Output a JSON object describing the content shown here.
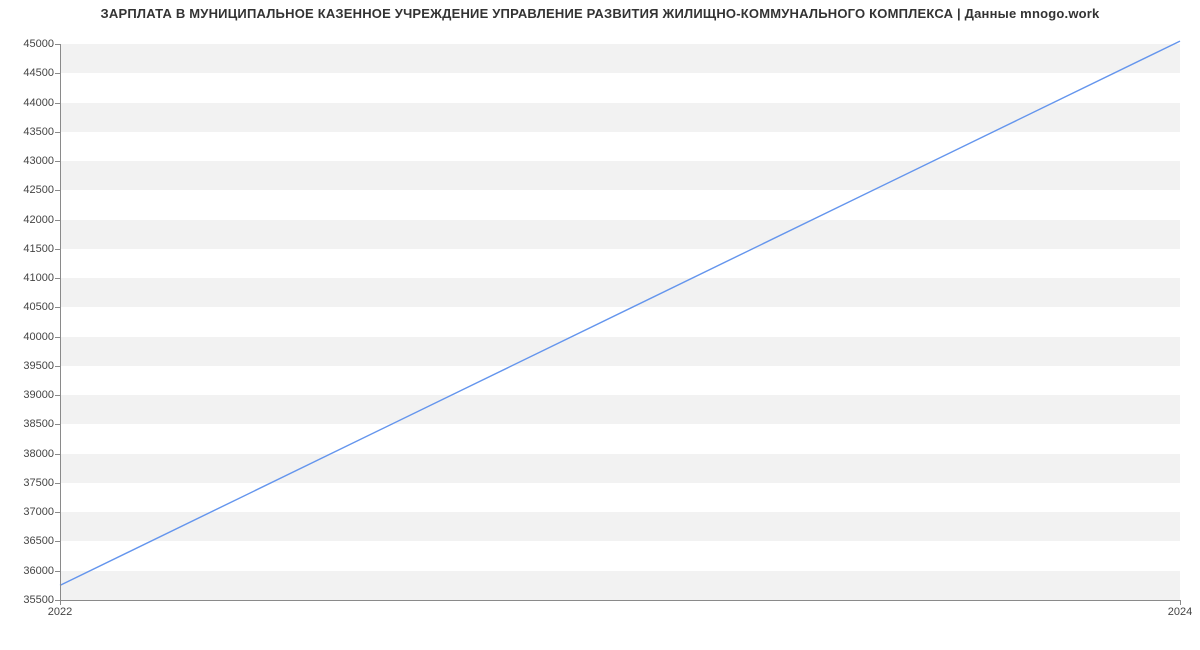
{
  "chart_data": {
    "type": "line",
    "title": "ЗАРПЛАТА В МУНИЦИПАЛЬНОЕ КАЗЕННОЕ УЧРЕЖДЕНИЕ УПРАВЛЕНИЕ РАЗВИТИЯ ЖИЛИЩНО-КОММУНАЛЬНОГО КОМПЛЕКСА | Данные mnogo.work",
    "xlabel": "",
    "ylabel": "",
    "x": [
      2022,
      2024
    ],
    "values": [
      35750,
      45050
    ],
    "x_ticks": [
      2022,
      2024
    ],
    "y_ticks": [
      35500,
      36000,
      36500,
      37000,
      37500,
      38000,
      38500,
      39000,
      39500,
      40000,
      40500,
      41000,
      41500,
      42000,
      42500,
      43000,
      43500,
      44000,
      44500,
      45000
    ],
    "xlim": [
      2022,
      2024
    ],
    "ylim": [
      35500,
      45000
    ],
    "line_color": "#6495ed",
    "band_color": "#f2f2f2",
    "grid": true
  }
}
